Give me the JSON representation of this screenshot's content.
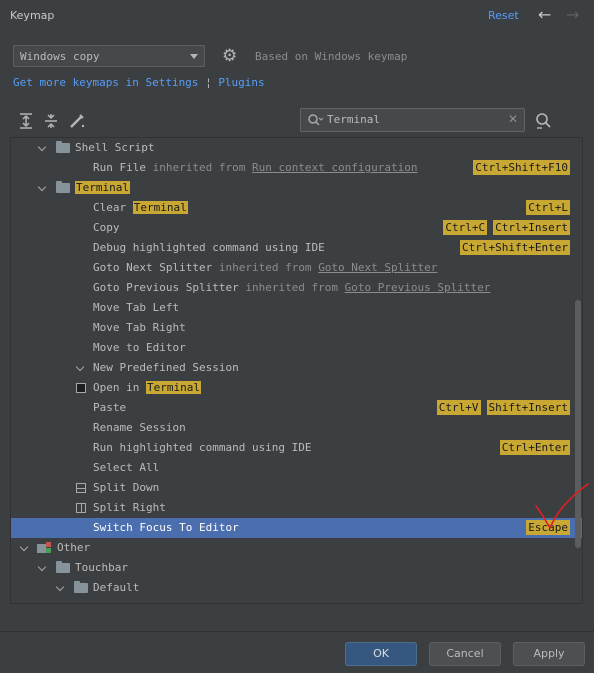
{
  "header": {
    "title": "Keymap",
    "reset_label": "Reset",
    "back_icon": "←",
    "forward_icon": "→"
  },
  "keymap_select": {
    "value": "Windows copy",
    "based_on": "Based on Windows keymap"
  },
  "links": {
    "settings": "Get more keymaps in Settings",
    "separator": "¦",
    "plugins": "Plugins"
  },
  "toolbar": {
    "icons": [
      "expand-all-icon",
      "collapse-all-icon",
      "edit-shortcut-icon"
    ],
    "search_value": "Terminal",
    "find_shortcut_icon": "find-by-shortcut-icon"
  },
  "tree": {
    "shell_script": "Shell Script",
    "run_file": "Run File",
    "inherited_from": "inherited from",
    "run_file_inherit": "Run context configuration",
    "run_file_sc": "Ctrl+Shift+F10",
    "terminal": "Terminal",
    "clear_prefix": "Clear ",
    "clear_hl": "Terminal",
    "clear_sc": "Ctrl+L",
    "copy": "Copy",
    "copy_sc1": "Ctrl+C",
    "copy_sc2": "Ctrl+Insert",
    "debug": "Debug highlighted command using IDE",
    "debug_sc": "Ctrl+Shift+Enter",
    "goto_next": "Goto Next Splitter",
    "goto_next_inherit": "Goto Next Splitter",
    "goto_prev": "Goto Previous Splitter",
    "goto_prev_inherit": "Goto Previous Splitter",
    "move_left": "Move Tab Left",
    "move_right": "Move Tab Right",
    "move_editor": "Move to Editor",
    "new_session": "New Predefined Session",
    "open_prefix": "Open in ",
    "open_hl": "Terminal",
    "paste": "Paste",
    "paste_sc1": "Ctrl+V",
    "paste_sc2": "Shift+Insert",
    "rename": "Rename Session",
    "run_hl": "Run highlighted command using IDE",
    "run_hl_sc": "Ctrl+Enter",
    "select_all": "Select All",
    "split_down": "Split Down",
    "split_right": "Split Right",
    "switch_focus": "Switch Focus To Editor",
    "switch_focus_sc": "Escape",
    "other": "Other",
    "touchbar": "Touchbar",
    "default": "Default"
  },
  "buttons": {
    "ok": "OK",
    "cancel": "Cancel",
    "apply": "Apply"
  },
  "colors": {
    "accent": "#589df6",
    "selection": "#4b6eaf",
    "highlight": "#c8a832",
    "annotation": "#e02020"
  }
}
